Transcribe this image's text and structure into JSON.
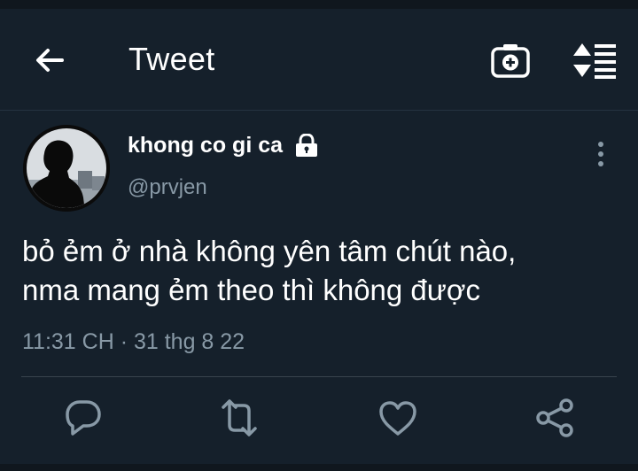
{
  "header": {
    "title": "Tweet",
    "back_icon": "arrow-left-icon",
    "camera_icon": "camera-icon",
    "sort_icon": "sort-icon"
  },
  "tweet": {
    "author_name": "khong co gi ca",
    "handle": "@prvjen",
    "locked": true,
    "text_lines": [
      "bỏ ẻm ở nhà không yên tâm chút nào,",
      "nma mang ẻm theo thì không được"
    ],
    "timestamp": "11:31 CH · 31 thg 8 22"
  },
  "actions": [
    "reply-icon",
    "retweet-icon",
    "like-icon",
    "share-icon"
  ],
  "colors": {
    "background": "#15202b",
    "secondary_text": "#8899a6",
    "divider": "#38444d"
  }
}
